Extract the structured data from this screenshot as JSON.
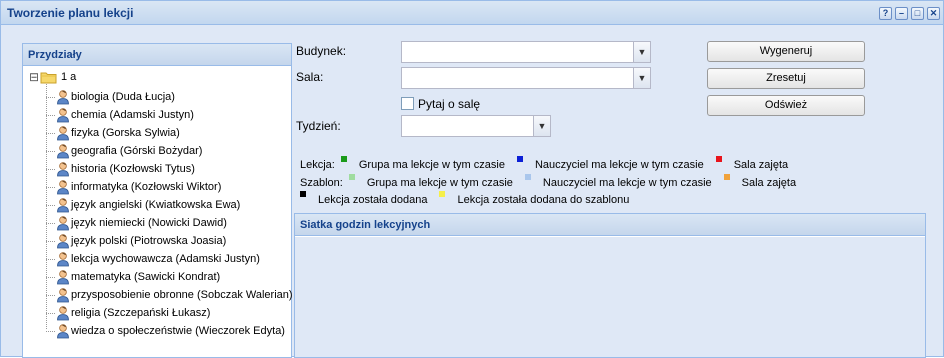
{
  "window": {
    "title": "Tworzenie planu lekcji",
    "tools": [
      "?",
      "–",
      "□",
      "✕"
    ]
  },
  "assignments": {
    "header": "Przydziały",
    "root": {
      "toggle": "⊟",
      "label": "1 a"
    },
    "items": [
      "biologia (Duda Łucja)",
      "chemia (Adamski Justyn)",
      "fizyka (Gorska Sylwia)",
      "geografia (Górski Bożydar)",
      "historia (Kozłowski Tytus)",
      "informatyka (Kozłowski Wiktor)",
      "język angielski (Kwiatkowska Ewa)",
      "język niemiecki (Nowicki Dawid)",
      "język polski (Piotrowska Joasia)",
      "lekcja wychowawcza (Adamski Justyn)",
      "matematyka (Sawicki Kondrat)",
      "przysposobienie obronne (Sobczak Walerian)",
      "religia (Szczepański Łukasz)",
      "wiedza o społeczeństwie (Wieczorek Edyta)"
    ]
  },
  "form": {
    "building_label": "Budynek:",
    "building_value": "",
    "room_label": "Sala:",
    "room_value": "",
    "ask_room_label": "Pytaj o salę",
    "ask_room_checked": false,
    "week_label": "Tydzień:",
    "week_value": ""
  },
  "buttons": {
    "generate": "Wygeneruj",
    "reset": "Zresetuj",
    "refresh": "Odśwież"
  },
  "legend": {
    "lesson_label": "Lekcja:",
    "template_label": "Szablon:",
    "lesson_items": [
      {
        "text": "Grupa ma lekcje w tym czasie",
        "color": "#1a9a1a"
      },
      {
        "text": "Nauczyciel ma lekcje w tym czasie",
        "color": "#0b1fd6"
      },
      {
        "text": "Sala zajęta",
        "color": "#e8141c"
      }
    ],
    "template_items": [
      {
        "text": "Grupa ma lekcje w tym czasie",
        "color": "#9fdc9f"
      },
      {
        "text": "Nauczyciel ma lekcje w tym czasie",
        "color": "#a9c6ec"
      },
      {
        "text": "Sala zajęta",
        "color": "#f0a23c"
      }
    ],
    "added_items": [
      {
        "text": "Lekcja została dodana",
        "color": "#000000"
      },
      {
        "text": "Lekcja została dodana do szablonu",
        "color": "#f5ef4a"
      }
    ]
  },
  "grid": {
    "header": "Siatka godzin lekcyjnych"
  }
}
